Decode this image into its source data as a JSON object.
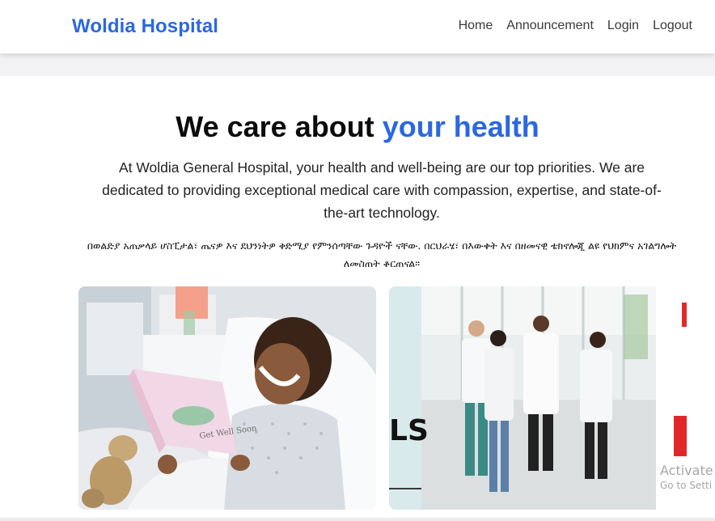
{
  "navbar": {
    "brand": "Woldia Hospital",
    "links": [
      "Home",
      "Announcement",
      "Login",
      "Logout"
    ]
  },
  "hero": {
    "title_plain": "We care about ",
    "title_accent": "your health",
    "subtitle": "At Woldia General Hospital, your health and well-being are our top priorities. We are dedicated to providing exceptional medical care with compassion, expertise, and state-of-the-art technology.",
    "amharic": "በወልድያ አጠቃላይ ሆስፒታል፣ ጤናዎ እና ደህንነትዎ ቅድሚያ የምንሰጣቸው ጉዳዮች ናቸው. በርህራሄ፣ በእውቀት እና በዘመናዊ ቴክኖሎጂ ልዩ የህክምና አገልግሎት ለመስጠት ቆርጠናል።"
  },
  "images": {
    "card_text": "Get Well Soon",
    "sign_text": "LS"
  },
  "watermark": {
    "line1": "Activate",
    "line2": "Go to Setti"
  },
  "colors": {
    "accent": "#2b68e0",
    "nav_text": "#3a3a3a",
    "page_bg": "#f3f3f5"
  }
}
